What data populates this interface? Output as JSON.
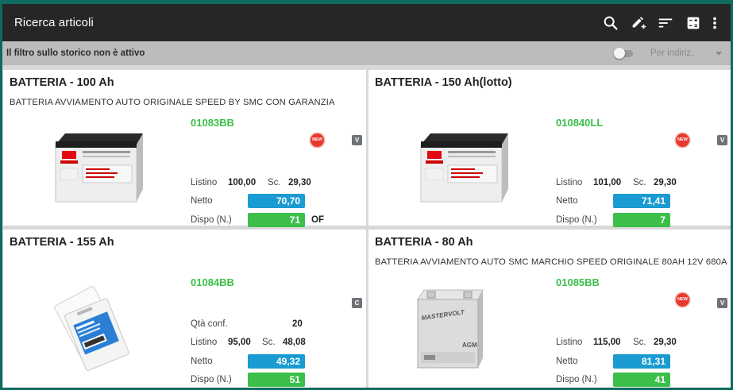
{
  "header": {
    "title": "Ricerca articoli",
    "icons": [
      "search-icon",
      "edit-add-icon",
      "sort-icon",
      "calculator-icon",
      "more-vert-icon"
    ]
  },
  "filter": {
    "text": "Il filtro sullo storico non è attivo",
    "toggle_on": false,
    "select_value": "Per indiriz."
  },
  "labels": {
    "listino": "Listino",
    "sconto": "Sc.",
    "netto": "Netto",
    "dispo": "Dispo (N.)",
    "qta_conf": "Qtà conf."
  },
  "colors": {
    "topbar": "#262626",
    "code_green": "#3cbf4a",
    "netto_blue": "#1a9bd1",
    "dispo_green": "#3cbf4a",
    "new_badge": "#e53a2d"
  },
  "cards": [
    {
      "title": "BATTERIA - 100 Ah",
      "description": "BATTERIA AVVIAMENTO AUTO ORIGINALE SPEED BY SMC CON GARANZIA",
      "code": "01083BB",
      "new_badge": "NEW",
      "class_badge": "V",
      "listino": "100,00",
      "sconto": "29,30",
      "netto": "70,70",
      "dispo": "71",
      "dispo_note": "OF",
      "image": "yuasa-battery-image"
    },
    {
      "title": "BATTERIA - 150 Ah(lotto)",
      "description": "",
      "code": "010840LL",
      "new_badge": "NEW",
      "class_badge": "V",
      "listino": "101,00",
      "sconto": "29,30",
      "netto": "71,41",
      "dispo": "7",
      "dispo_note": "",
      "image": "yuasa-battery-image"
    },
    {
      "title": "BATTERIA - 155 Ah",
      "description": "",
      "code": "01084BB",
      "new_badge": "",
      "class_badge": "C",
      "qta_conf": "20",
      "listino": "95,00",
      "sconto": "48,08",
      "netto": "49,32",
      "dispo": "51",
      "dispo_note": "",
      "image": "phone-battery-image"
    },
    {
      "title": "BATTERIA - 80 Ah",
      "description": "BATTERIA AVVIAMENTO AUTO SMC MARCHIO SPEED ORIGINALE 80AH 12V 680A",
      "code": "01085BB",
      "new_badge": "NEW",
      "class_badge": "V",
      "listino": "115,00",
      "sconto": "29,30",
      "netto": "81,31",
      "dispo": "41",
      "dispo_note": "",
      "image": "mastervolt-battery-image",
      "image_brand": "MASTERVOLT",
      "image_model": "AGM"
    }
  ]
}
